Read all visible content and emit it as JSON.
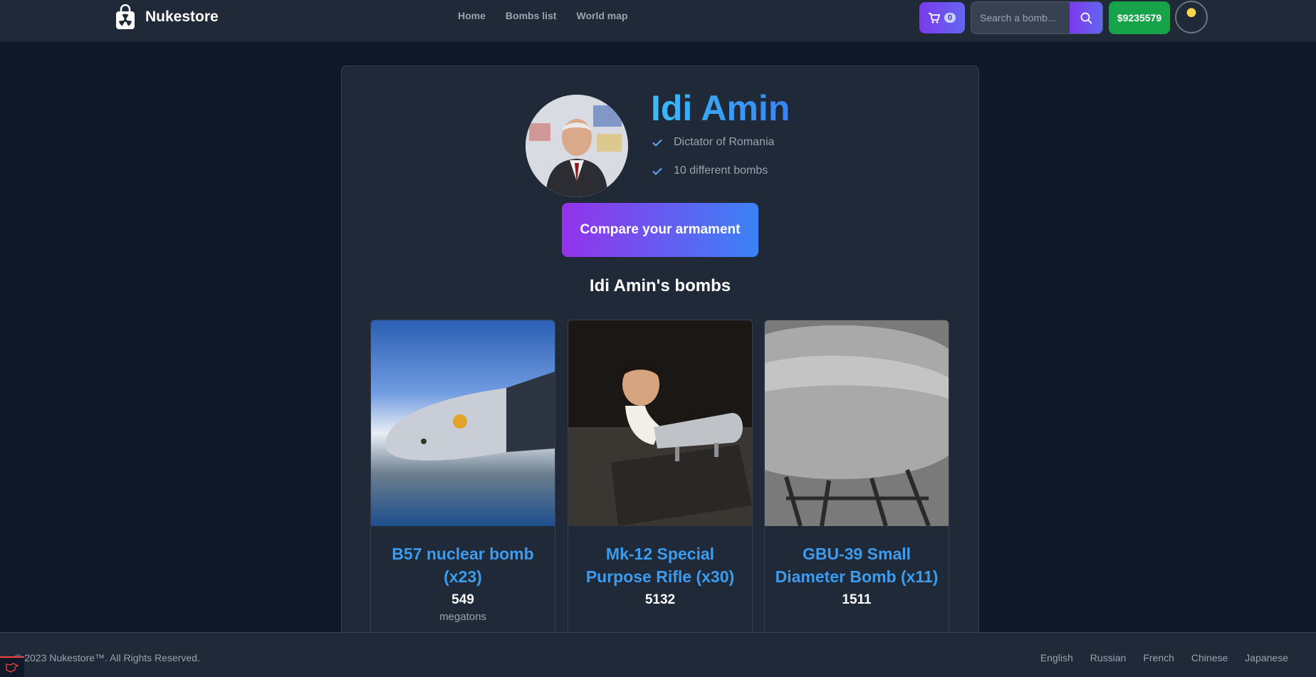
{
  "navbar": {
    "brand": "Nukestore",
    "links": [
      "Home",
      "Bombs list",
      "World map"
    ],
    "cart_count": "0",
    "search_placeholder": "Search a bomb...",
    "balance": "$9235579"
  },
  "profile": {
    "name": "Idi Amin",
    "facts": [
      "Dictator of Romania",
      "10 different bombs"
    ],
    "compare_label": "Compare your armament",
    "section_title": "Idi Amin's bombs"
  },
  "bombs": [
    {
      "title": "B57 nuclear bomb (x23)",
      "stat": "549",
      "unit": "megatons"
    },
    {
      "title": "Mk-12 Special Purpose Rifle (x30)",
      "stat": "5132",
      "unit": ""
    },
    {
      "title": "GBU-39 Small Diameter Bomb (x11)",
      "stat": "1511",
      "unit": ""
    }
  ],
  "footer": {
    "copyright": "© 2023 Nukestore™. All Rights Reserved.",
    "languages": [
      "English",
      "Russian",
      "French",
      "Chinese",
      "Japanese"
    ]
  },
  "colors": {
    "accent_purple": "#7c3aed",
    "accent_blue": "#3b82f6",
    "balance_green": "#16a34a",
    "background": "#0f1729"
  },
  "icons": [
    "shopping-bag-radiation-icon",
    "cart-icon",
    "search-icon",
    "check-icon",
    "framework-logo-icon"
  ]
}
